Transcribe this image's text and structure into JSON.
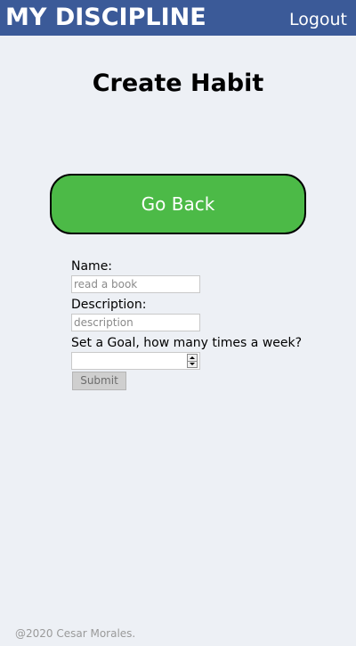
{
  "header": {
    "brand": "MY DISCIPLINE",
    "logout_label": "Logout",
    "background_color": "#3b5a98"
  },
  "page": {
    "title": "Create Habit",
    "background_color": "#edf0f5"
  },
  "go_back": {
    "label": "Go Back",
    "color": "#4cba47"
  },
  "form": {
    "name_label": "Name:",
    "name_placeholder": "read a book",
    "name_value": "",
    "description_label": "Description:",
    "description_placeholder": "description",
    "description_value": "",
    "goal_label": "Set a Goal, how many times a week?",
    "goal_value": "",
    "submit_label": "Submit"
  },
  "footer": {
    "text": "@2020 Cesar Morales."
  }
}
